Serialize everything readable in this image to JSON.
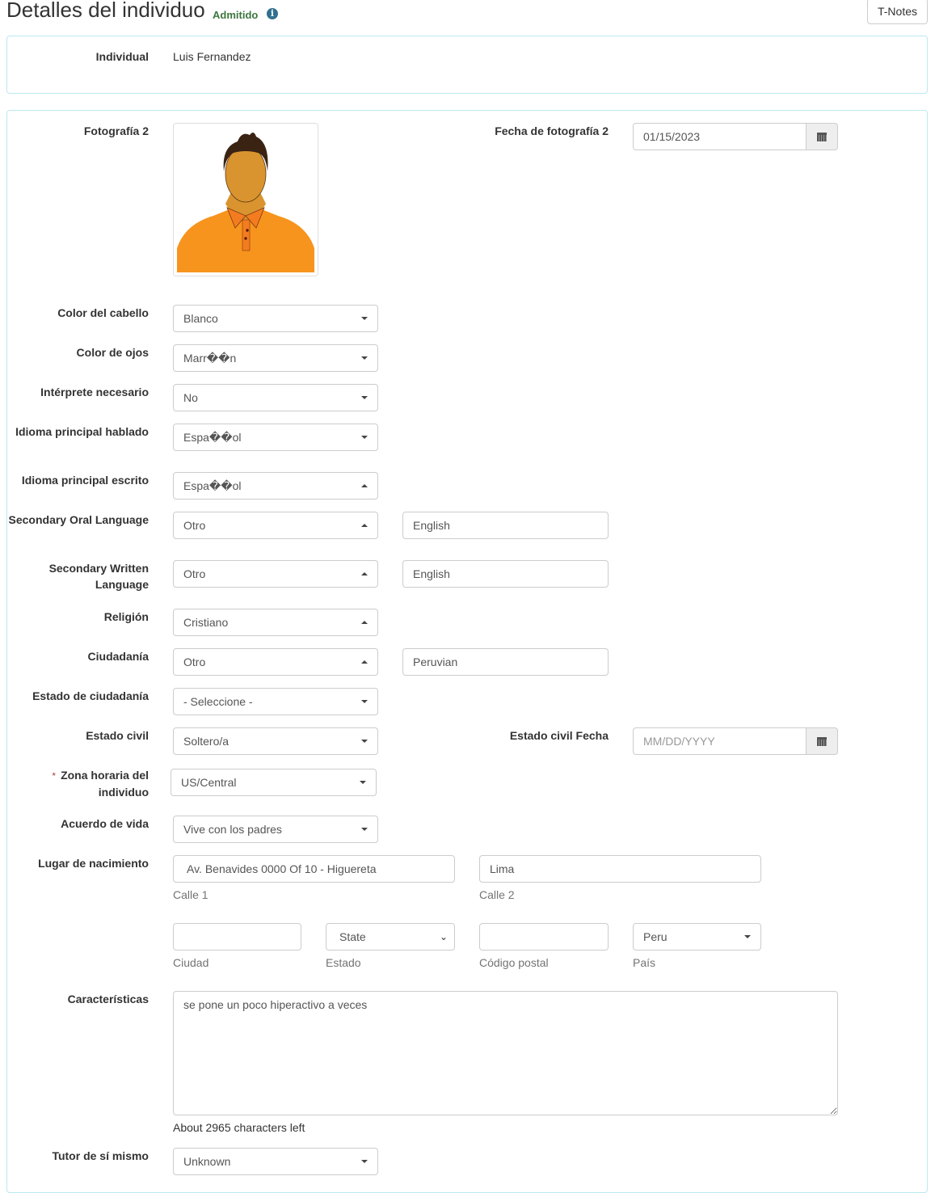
{
  "header": {
    "title": "Detalles del individuo",
    "status": "Admitido",
    "info_icon": "info-circle-icon",
    "tnotes_label": "T-Notes"
  },
  "individual": {
    "label": "Individual",
    "value": "Luis Fernandez"
  },
  "photo": {
    "label": "Fotografía 2",
    "date_label": "Fecha de fotografía 2",
    "date_value": "01/15/2023",
    "calendar_icon": "calendar-icon"
  },
  "fields": {
    "hair_color": {
      "label": "Color del cabello",
      "value": "Blanco"
    },
    "eye_color": {
      "label": "Color de ojos",
      "value": "Marr��n"
    },
    "interpreter": {
      "label": "Intérprete necesario",
      "value": "No"
    },
    "primary_spoken": {
      "label": "Idioma principal hablado",
      "value": "Espa��ol"
    },
    "primary_written": {
      "label": "Idioma principal escrito",
      "value": "Espa��ol"
    },
    "secondary_oral": {
      "label": "Secondary Oral Language",
      "value": "Otro",
      "other": "English"
    },
    "secondary_written": {
      "label": "Secondary Written Language",
      "value": "Otro",
      "other": "English"
    },
    "religion": {
      "label": "Religión",
      "value": "Cristiano"
    },
    "citizenship": {
      "label": "Ciudadanía",
      "value": "Otro",
      "other": "Peruvian"
    },
    "citizenship_status": {
      "label": "Estado de ciudadanía",
      "value": "- Seleccione -"
    },
    "marital_status": {
      "label": "Estado civil",
      "value": "Soltero/a",
      "date_label": "Estado civil Fecha",
      "date_placeholder": "MM/DD/YYYY"
    },
    "timezone": {
      "required_mark": "*",
      "label": "Zona horaria del individuo",
      "value": "US/Central"
    },
    "living": {
      "label": "Acuerdo de vida",
      "value": "Vive con los padres"
    },
    "self_guardian": {
      "label": "Tutor de sí mismo",
      "value": "Unknown"
    }
  },
  "birthplace": {
    "label": "Lugar de nacimiento",
    "street1": {
      "value": "Av. Benavides 0000 Of 10 - Higuereta",
      "help": "Calle 1"
    },
    "street2": {
      "value": "Lima",
      "help": "Calle 2"
    },
    "city": {
      "value": "",
      "help": "Ciudad"
    },
    "state": {
      "value": "State",
      "help": "Estado"
    },
    "zip": {
      "value": "",
      "help": "Código postal"
    },
    "country": {
      "value": "Peru",
      "help": "País"
    }
  },
  "characteristics": {
    "label": "Características",
    "value": "se pone un poco hiperactivo a veces",
    "chars_left": "About 2965 characters left"
  }
}
